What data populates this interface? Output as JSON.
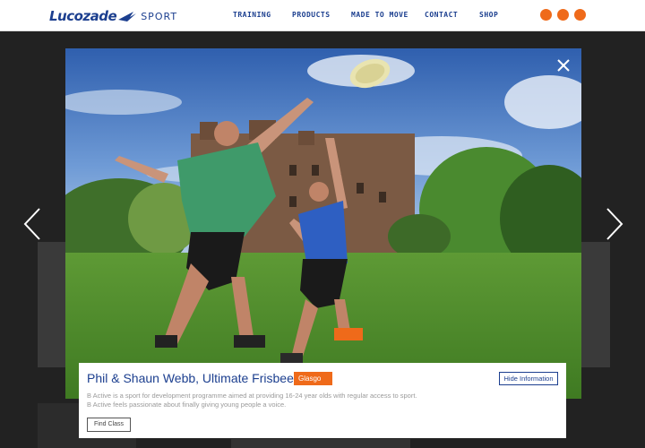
{
  "header": {
    "logo_text": "Lucozade",
    "logo_sub": "SPORT",
    "nav": [
      "TRAINING",
      "PRODUCTS",
      "MADE TO MOVE",
      "CONTACT",
      "SHOP"
    ],
    "social_icons": [
      "social-icon",
      "social-icon",
      "social-icon"
    ],
    "accent_color": "#ef6a1a",
    "brand_color": "#1c3f8f"
  },
  "lightbox": {
    "image_alt": "Phil & Shaun Webb jumping for a frisbee",
    "close_icon": "close-icon",
    "prev_icon": "chevron-left-icon",
    "next_icon": "chevron-right-icon"
  },
  "info": {
    "title": "Phil & Shaun Webb, Ultimate Frisbee",
    "tag": "Glasgo",
    "hide_label": "Hide Information",
    "description": "B Active is a sport for development programme aimed at providing 16-24 year olds with regular access to sport. B Active feels passionate about finally giving young people a voice.",
    "find_label": "Find Class"
  }
}
